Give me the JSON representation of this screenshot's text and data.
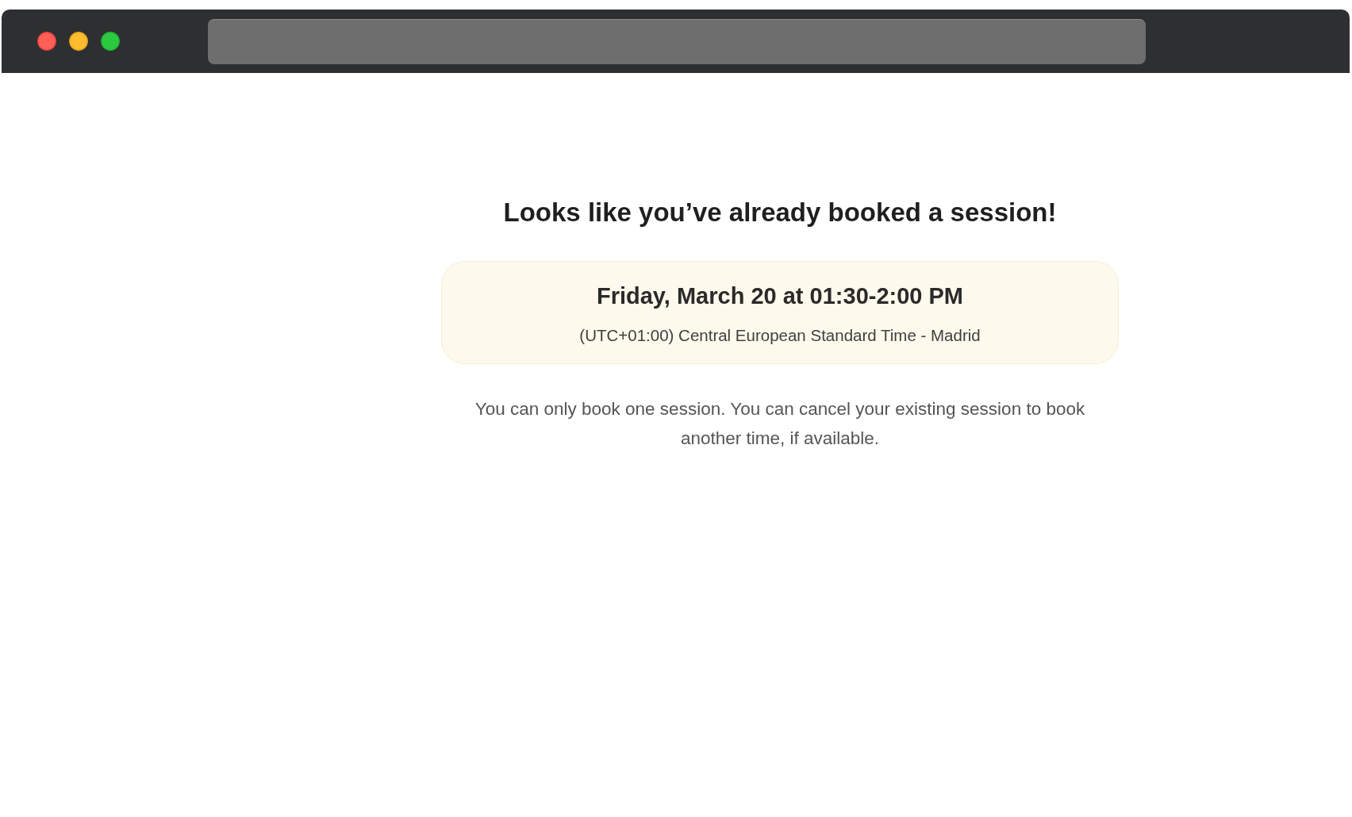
{
  "heading": "Looks like you’ve already booked a session!",
  "booking_card": {
    "date_time": "Friday, March 20 at 01:30-2:00 PM",
    "timezone": "(UTC+01:00) Central European Standard Time - Madrid"
  },
  "note": "You can only book one session. You can cancel your existing session to book another time, if available."
}
